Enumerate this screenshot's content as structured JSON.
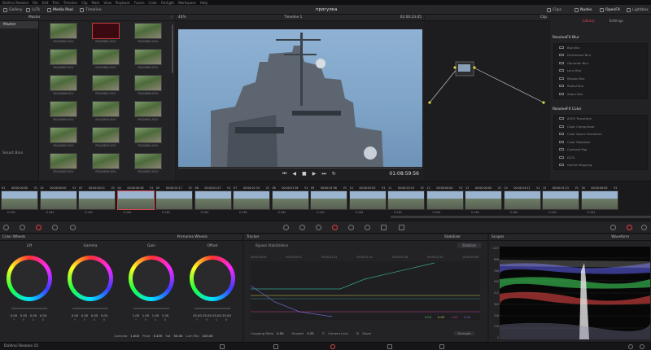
{
  "menubar": [
    "DaVinci Resolve",
    "File",
    "Edit",
    "Trim",
    "Timeline",
    "Clip",
    "Mark",
    "View",
    "Playback",
    "Fusion",
    "Color",
    "Fairlight",
    "Workspace",
    "Help"
  ],
  "toolbar": {
    "gallery": "Gallery",
    "luts": "LUTs",
    "media_pool": "Media Pool",
    "timeline": "Timeline",
    "project_title": "прогулка",
    "clips": "Clips",
    "nodes": "Nodes",
    "openfx": "OpenFX",
    "lightbox": "Lightbox"
  },
  "media_pool": {
    "header": "Master",
    "folders": [
      "Master"
    ],
    "smart_bins": "Smart Bins",
    "clips": [
      "P0008880.MOV",
      "P0008881.MOV",
      "P0008882.MOV",
      "P0008883.MOV",
      "P0008884.MOV",
      "P0008885.MOV",
      "P0008886.MOV",
      "P0008887.MOV",
      "P0008888.MOV",
      "P0008889.MOV",
      "P0008890.MOV",
      "P0008891.MOV",
      "P0008892.MOV",
      "P0008893.MOV",
      "P0008894.MOV",
      "P0008895.MOV",
      "P0008896.MOV",
      "P0008897.MOV"
    ]
  },
  "viewer": {
    "zoom": "40%",
    "timeline_name": "Timeline 1",
    "timecode_top": "02:00:23:45",
    "clip_label": "Clip",
    "timecode": "01:08:59:56"
  },
  "library": {
    "tab_library": "Library",
    "tab_settings": "Settings",
    "section_blur": "ResolveFX Blur",
    "blur_items": [
      "Box Blur",
      "Directional Blur",
      "Gaussian Blur",
      "Lens Blur",
      "Mosaic Blur",
      "Radial Blur",
      "Zoom Blur"
    ],
    "section_color": "ResolveFX Color",
    "color_items": [
      "ACES Transform",
      "Color Compressor",
      "Color Space Transform",
      "Color Stabilizer",
      "Contrast Pop",
      "DCTL",
      "Gamut Mapping"
    ]
  },
  "timeline": {
    "clips": [
      {
        "n": "01",
        "tc": "00:00:00:00",
        "v": "V1"
      },
      {
        "n": "02",
        "tc": "00:00:00:00",
        "v": "V1"
      },
      {
        "n": "03",
        "tc": "00:00:00:21",
        "v": "V1"
      },
      {
        "n": "04",
        "tc": "00:00:00:46",
        "v": "V1"
      },
      {
        "n": "05",
        "tc": "00:00:01:17",
        "v": "V1"
      },
      {
        "n": "06",
        "tc": "00:00:01:23",
        "v": "V1"
      },
      {
        "n": "07",
        "tc": "00:00:01:34",
        "v": "V1"
      },
      {
        "n": "08",
        "tc": "00:00:01:36",
        "v": "V1"
      },
      {
        "n": "09",
        "tc": "00:00:01:56",
        "v": "V1"
      },
      {
        "n": "10",
        "tc": "00:00:02:05",
        "v": "V1"
      },
      {
        "n": "11",
        "tc": "00:00:02:19",
        "v": "V1"
      },
      {
        "n": "12",
        "tc": "00:00:00:00",
        "v": "V1"
      },
      {
        "n": "13",
        "tc": "00:00:00:00",
        "v": "V1"
      },
      {
        "n": "14",
        "tc": "00:00:24:22",
        "v": "V1"
      },
      {
        "n": "15",
        "tc": "00:00:01:23",
        "v": "V1"
      },
      {
        "n": "16",
        "tc": "00:00:00:00",
        "v": "V1"
      }
    ],
    "codec": "H.264"
  },
  "color_wheels": {
    "title": "Color Wheels",
    "mode": "Primaries Wheels",
    "wheels": [
      {
        "label": "Lift",
        "vals": [
          "0.00",
          "0.00",
          "0.00",
          "0.00"
        ]
      },
      {
        "label": "Gamma",
        "vals": [
          "0.00",
          "0.00",
          "0.00",
          "0.00"
        ]
      },
      {
        "label": "Gain",
        "vals": [
          "1.00",
          "1.00",
          "1.00",
          "1.00"
        ]
      },
      {
        "label": "Offset",
        "vals": [
          "25.00",
          "25.00",
          "25.00",
          "25.00"
        ]
      }
    ],
    "channel_letters": [
      "Y",
      "R",
      "G",
      "B"
    ],
    "footer": {
      "contrast_label": "Contrast",
      "contrast": "1.000",
      "pivot_label": "Pivot",
      "pivot": "0.435",
      "sat_label": "Sat",
      "sat": "50.00",
      "lum_label": "Lum Mix",
      "lum": "100.00"
    }
  },
  "tracker": {
    "title": "Tracker",
    "mode": "Stabilizer",
    "sub_title": "Bypass Stabilization",
    "stab_button": "Stabilize",
    "ruler": [
      "00:00:00:00",
      "00:00:00:21",
      "00:00:01:12",
      "00:00:01:14",
      "00:00:01:16",
      "00:00:01:20",
      "00:00:02:06"
    ],
    "values": [
      "0.04",
      "0.00",
      "1.00",
      "0.00"
    ],
    "footer": {
      "crop_label": "Cropping Ratio",
      "crop": "0.50",
      "smooth_label": "Smooth",
      "smooth": "0.25",
      "lock_label": "Camera Lock",
      "zoom_label": "Zoom",
      "strength": "Strength"
    }
  },
  "scopes": {
    "title": "Scopes",
    "mode": "Waveform",
    "scale": [
      "1023",
      "896",
      "768",
      "640",
      "512",
      "384",
      "256",
      "128",
      "0"
    ]
  },
  "status": {
    "app": "DaVinci Resolve 15"
  }
}
